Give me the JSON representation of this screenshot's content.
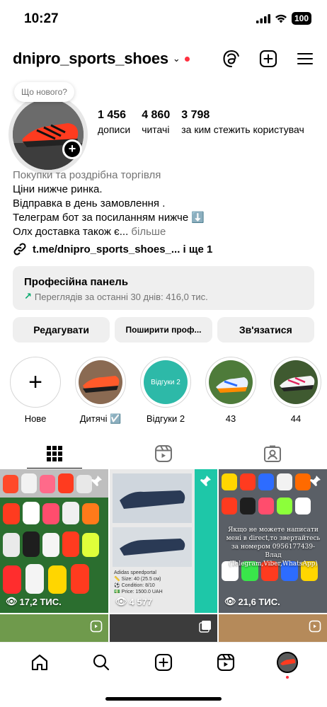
{
  "status": {
    "time": "10:27",
    "battery": "100"
  },
  "header": {
    "username": "dnipro_sports_shoes"
  },
  "note": "Що нового?",
  "stats": [
    {
      "num": "1 456",
      "label": "дописи"
    },
    {
      "num": "4 860",
      "label": "читачі"
    },
    {
      "num": "3 798",
      "label": "за ким стежить користувач"
    }
  ],
  "bio": {
    "category": "Покупки та роздрібна торгівля",
    "line1": "Ціни нижче ринка.",
    "line2": "Відправка в день замовлення .",
    "line3": "Телеграм бот за посиланням нижче ⬇️",
    "line4": "Олх доставка також є...",
    "more": "більше",
    "link": "t.me/dnipro_sports_shoes_... і ще 1"
  },
  "pro_panel": {
    "title": "Професійна панель",
    "subtitle": "Переглядів за останні 30 днів: 416,0 тис."
  },
  "actions": {
    "edit": "Редагувати",
    "share": "Поширити проф...",
    "contact": "Зв'язатися"
  },
  "highlights": [
    {
      "label": "Нове"
    },
    {
      "label": "Дитячі ☑️"
    },
    {
      "label": "Відгуки 2",
      "inner": "Відгуки 2"
    },
    {
      "label": "43"
    },
    {
      "label": "44"
    }
  ],
  "grid": {
    "post1_count": "17,2 ТИС.",
    "post2_count": "4 577",
    "post3_count": "21,6 ТИС.",
    "post2_caption": [
      "Adidas speedportal",
      "📏 Size: 40 (25.5 см)",
      "⚽️ Condition: 8/10",
      "💵 Price: 1500.0 UAH"
    ],
    "post3_text": "Якщо не можете написати мені в direct,то звертайтесь за номером 0956177439-Влад (Telegram,Viber,WhatsApp)"
  },
  "colors": {
    "accent": "#ff3040",
    "secondary_text": "#737373",
    "button_bg": "#efefef"
  }
}
